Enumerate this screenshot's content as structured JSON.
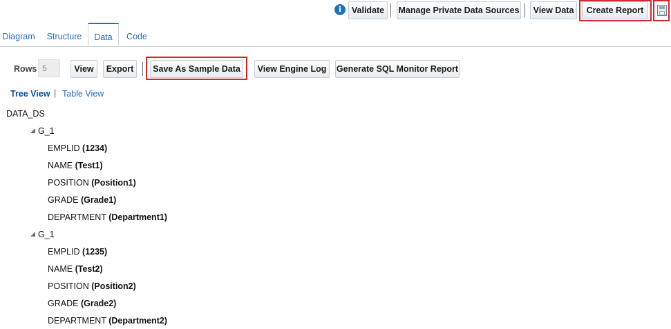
{
  "toolbar": {
    "info_icon": "i",
    "validate": "Validate",
    "manage_sources": "Manage Private Data Sources",
    "view_data": "View Data",
    "create_report": "Create Report",
    "save_icon": "save-icon"
  },
  "tabs": [
    "Diagram",
    "Structure",
    "Data",
    "Code"
  ],
  "active_tab": "Data",
  "data_toolbar": {
    "rows_label": "Rows",
    "rows_value": "5",
    "view": "View",
    "export": "Export",
    "save_sample": "Save As Sample Data",
    "view_engine_log": "View Engine Log",
    "sql_monitor": "Generate SQL Monitor Report"
  },
  "view_switch": {
    "tree": "Tree View",
    "separator": "|",
    "table": "Table View"
  },
  "tree": {
    "root": "DATA_DS",
    "groups": [
      {
        "name": "G_1",
        "fields": [
          {
            "key": "EMPLID",
            "value": "(1234)"
          },
          {
            "key": "NAME",
            "value": "(Test1)"
          },
          {
            "key": "POSITION",
            "value": "(Position1)"
          },
          {
            "key": "GRADE",
            "value": "(Grade1)"
          },
          {
            "key": "DEPARTMENT",
            "value": "(Department1)"
          }
        ]
      },
      {
        "name": "G_1",
        "fields": [
          {
            "key": "EMPLID",
            "value": "(1235)"
          },
          {
            "key": "NAME",
            "value": "(Test2)"
          },
          {
            "key": "POSITION",
            "value": "(Position2)"
          },
          {
            "key": "GRADE",
            "value": "(Grade2)"
          },
          {
            "key": "DEPARTMENT",
            "value": "(Department2)"
          }
        ]
      }
    ]
  },
  "colors": {
    "highlight_border": "#d7262e",
    "link_blue": "#2a6ebb",
    "info_blue": "#1e73be"
  }
}
